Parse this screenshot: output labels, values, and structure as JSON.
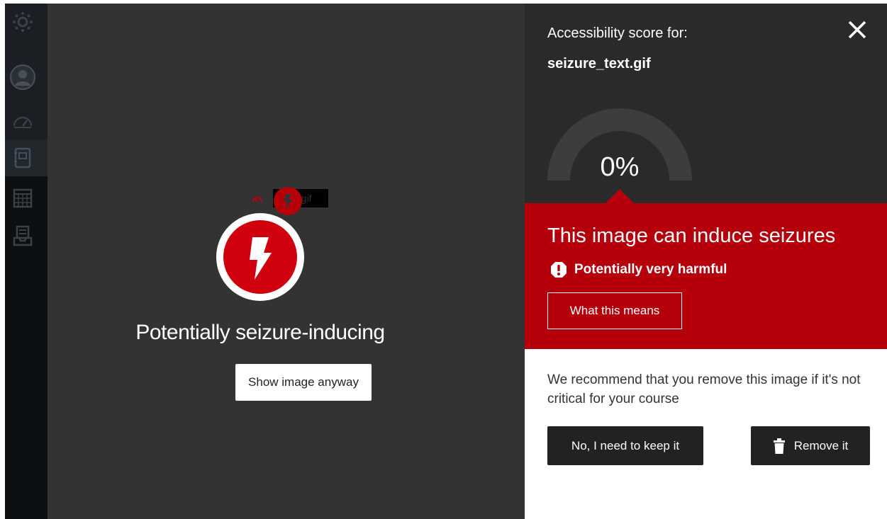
{
  "nav": {
    "items": [
      {
        "icon": "logo-icon",
        "active": false
      },
      {
        "icon": "account-icon",
        "active": false
      },
      {
        "icon": "dashboard-icon",
        "active": false
      },
      {
        "icon": "courses-icon",
        "active": true
      },
      {
        "icon": "calendar-icon",
        "active": false
      },
      {
        "icon": "inbox-icon",
        "active": false
      }
    ]
  },
  "preview": {
    "thumbnail_filename": "t.gif",
    "title": "Potentially seizure-inducing",
    "show_button": "Show image anyway",
    "icon": "lightning-bolt-icon"
  },
  "panel": {
    "score_label": "Accessibility score for:",
    "file_name": "seizure_text.gif",
    "score": "0%",
    "score_fraction": 0,
    "alert_title": "This image can induce seizures",
    "severity": "Potentially very harmful",
    "what_means_button": "What this means",
    "recommendation": "We recommend that you remove this image if it's not critical for your course",
    "keep_button": "No, I need to keep it",
    "remove_button": "Remove it"
  },
  "colors": {
    "danger": "#b5000b",
    "panel_dark": "#2a2a2a",
    "main_bg": "#333333",
    "rail_bg": "#0d1013"
  }
}
